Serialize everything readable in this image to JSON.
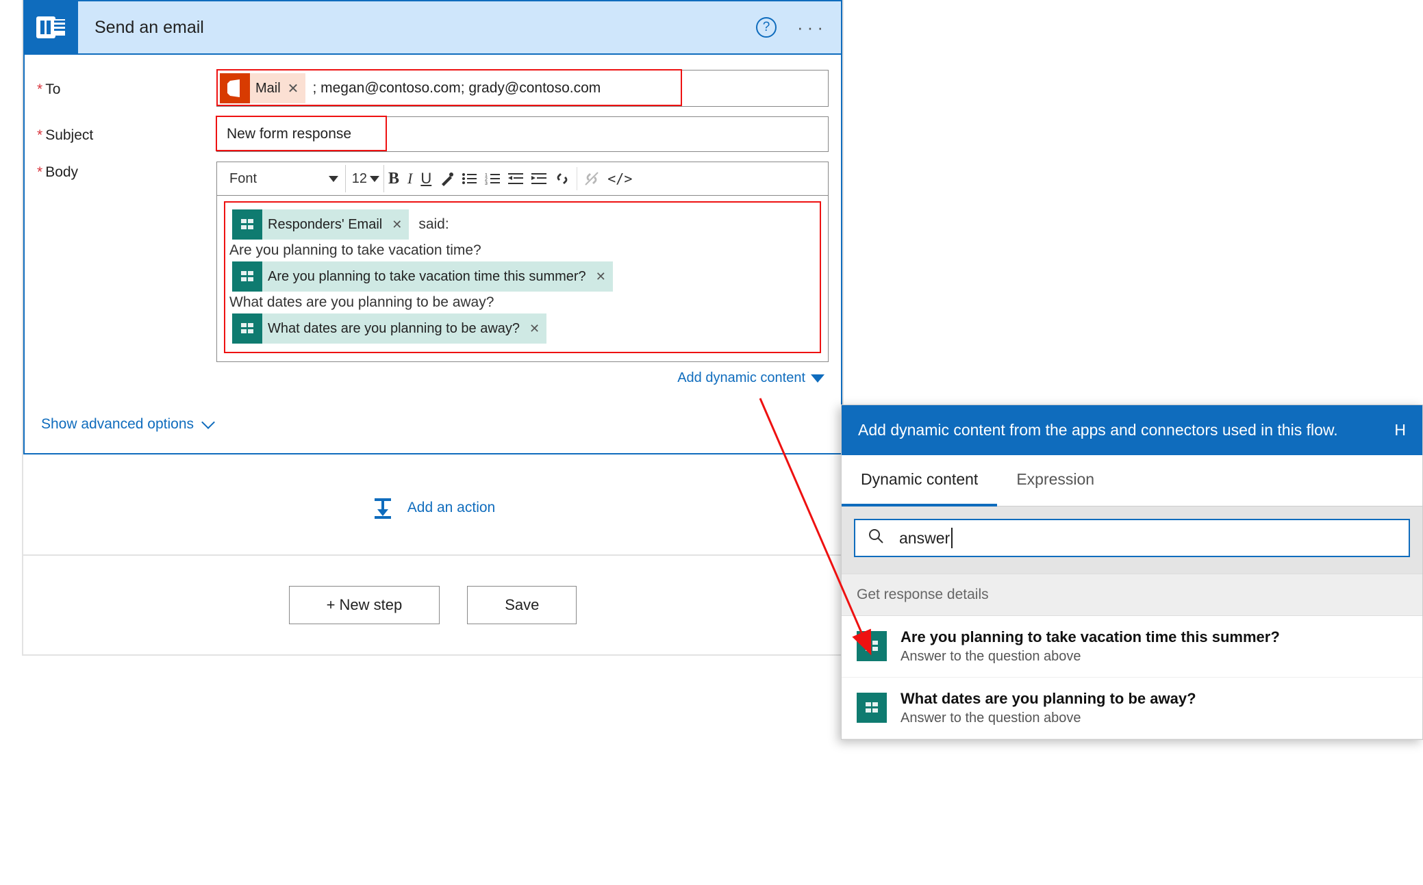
{
  "action": {
    "title": "Send an email",
    "more": "···"
  },
  "labels": {
    "to": "To",
    "subject": "Subject",
    "body": "Body",
    "font_label": "Font",
    "font_size": "12"
  },
  "to": {
    "token_label": "Mail",
    "text": "; megan@contoso.com; grady@contoso.com"
  },
  "subject": {
    "value": "New form response"
  },
  "body": {
    "tokens": {
      "responders_email": "Responders' Email",
      "q1": "Are you planning to take vacation time this summer?",
      "q2": "What dates are you planning to be away?"
    },
    "text_said": "said:",
    "line_q1": "Are you planning to take vacation time?",
    "line_q2": "What dates are you planning to be away?"
  },
  "links": {
    "add_dynamic": "Add dynamic content",
    "advanced": "Show advanced options",
    "add_action": "Add an action"
  },
  "buttons": {
    "new_step": "+ New step",
    "save": "Save"
  },
  "dyn": {
    "header": "Add dynamic content from the apps and connectors used in this flow.",
    "help_letter": "H",
    "tab_dynamic": "Dynamic content",
    "tab_expression": "Expression",
    "search_value": "answer",
    "section": "Get response details",
    "results": [
      {
        "title": "Are you planning to take vacation time this summer?",
        "sub": "Answer to the question above"
      },
      {
        "title": "What dates are you planning to be away?",
        "sub": "Answer to the question above"
      }
    ]
  }
}
